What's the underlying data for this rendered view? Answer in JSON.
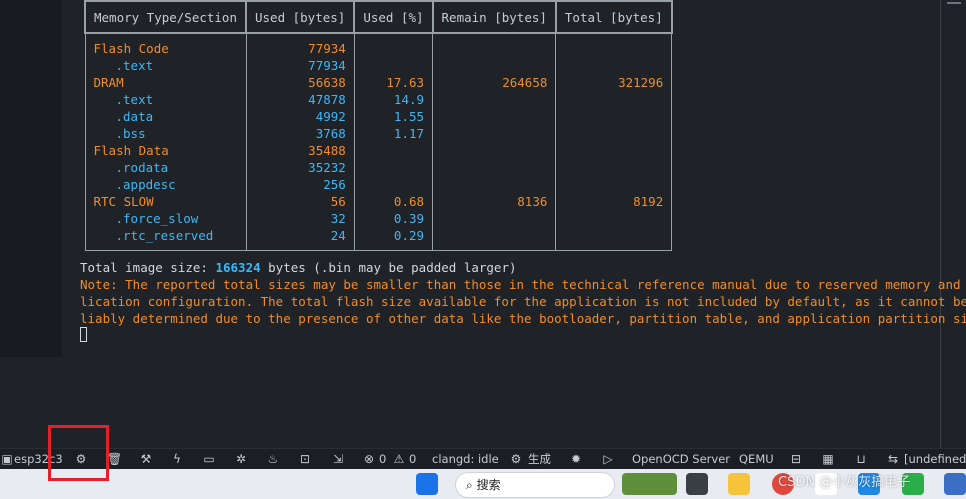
{
  "table": {
    "headers": [
      "Memory Type/Section",
      "Used [bytes]",
      "Used [%]",
      "Remain [bytes]",
      "Total [bytes]"
    ],
    "rows": [
      {
        "name": "Flash Code",
        "used": "77934",
        "pct": "",
        "remain": "",
        "total": "",
        "level": 0
      },
      {
        "name": ".text",
        "used": "77934",
        "pct": "",
        "remain": "",
        "total": "",
        "level": 1
      },
      {
        "name": "DRAM",
        "used": "56638",
        "pct": "17.63",
        "remain": "264658",
        "total": "321296",
        "level": 0
      },
      {
        "name": ".text",
        "used": "47878",
        "pct": "14.9",
        "remain": "",
        "total": "",
        "level": 1
      },
      {
        "name": ".data",
        "used": "4992",
        "pct": "1.55",
        "remain": "",
        "total": "",
        "level": 1
      },
      {
        "name": ".bss",
        "used": "3768",
        "pct": "1.17",
        "remain": "",
        "total": "",
        "level": 1
      },
      {
        "name": "Flash Data",
        "used": "35488",
        "pct": "",
        "remain": "",
        "total": "",
        "level": 0
      },
      {
        "name": ".rodata",
        "used": "35232",
        "pct": "",
        "remain": "",
        "total": "",
        "level": 1
      },
      {
        "name": ".appdesc",
        "used": "256",
        "pct": "",
        "remain": "",
        "total": "",
        "level": 1
      },
      {
        "name": "RTC SLOW",
        "used": "56",
        "pct": "0.68",
        "remain": "8136",
        "total": "8192",
        "level": 0
      },
      {
        "name": ".force_slow",
        "used": "32",
        "pct": "0.39",
        "remain": "",
        "total": "",
        "level": 1
      },
      {
        "name": ".rtc_reserved",
        "used": "24",
        "pct": "0.29",
        "remain": "",
        "total": "",
        "level": 1
      }
    ]
  },
  "output": {
    "total_prefix": "Total image size: ",
    "total_value": "166324",
    "total_suffix": " bytes (.bin may be padded larger)",
    "note_lines": [
      "Note: The reported total sizes may be smaller than those in the technical reference manual due to reserved memory and app",
      "lication configuration. The total flash size available for the application is not included by default, as it cannot be re",
      "liably determined due to the presence of other data like the bootloader, partition table, and application partition size."
    ]
  },
  "statusbar": {
    "target": "esp32c3",
    "errors": "0",
    "warnings": "0",
    "clangd": "clangd: idle",
    "build": "生成",
    "openocd": "OpenOCD Server",
    "qemu": "QEMU",
    "undefined": "[undefined]"
  },
  "taskbar": {
    "search_placeholder": "搜索"
  },
  "watermark": "CSDN @小灰灰搞电子",
  "colors": {
    "orange": "#f28c28",
    "cyan": "#3fb7f5",
    "highlight_box": "#e5202a"
  }
}
